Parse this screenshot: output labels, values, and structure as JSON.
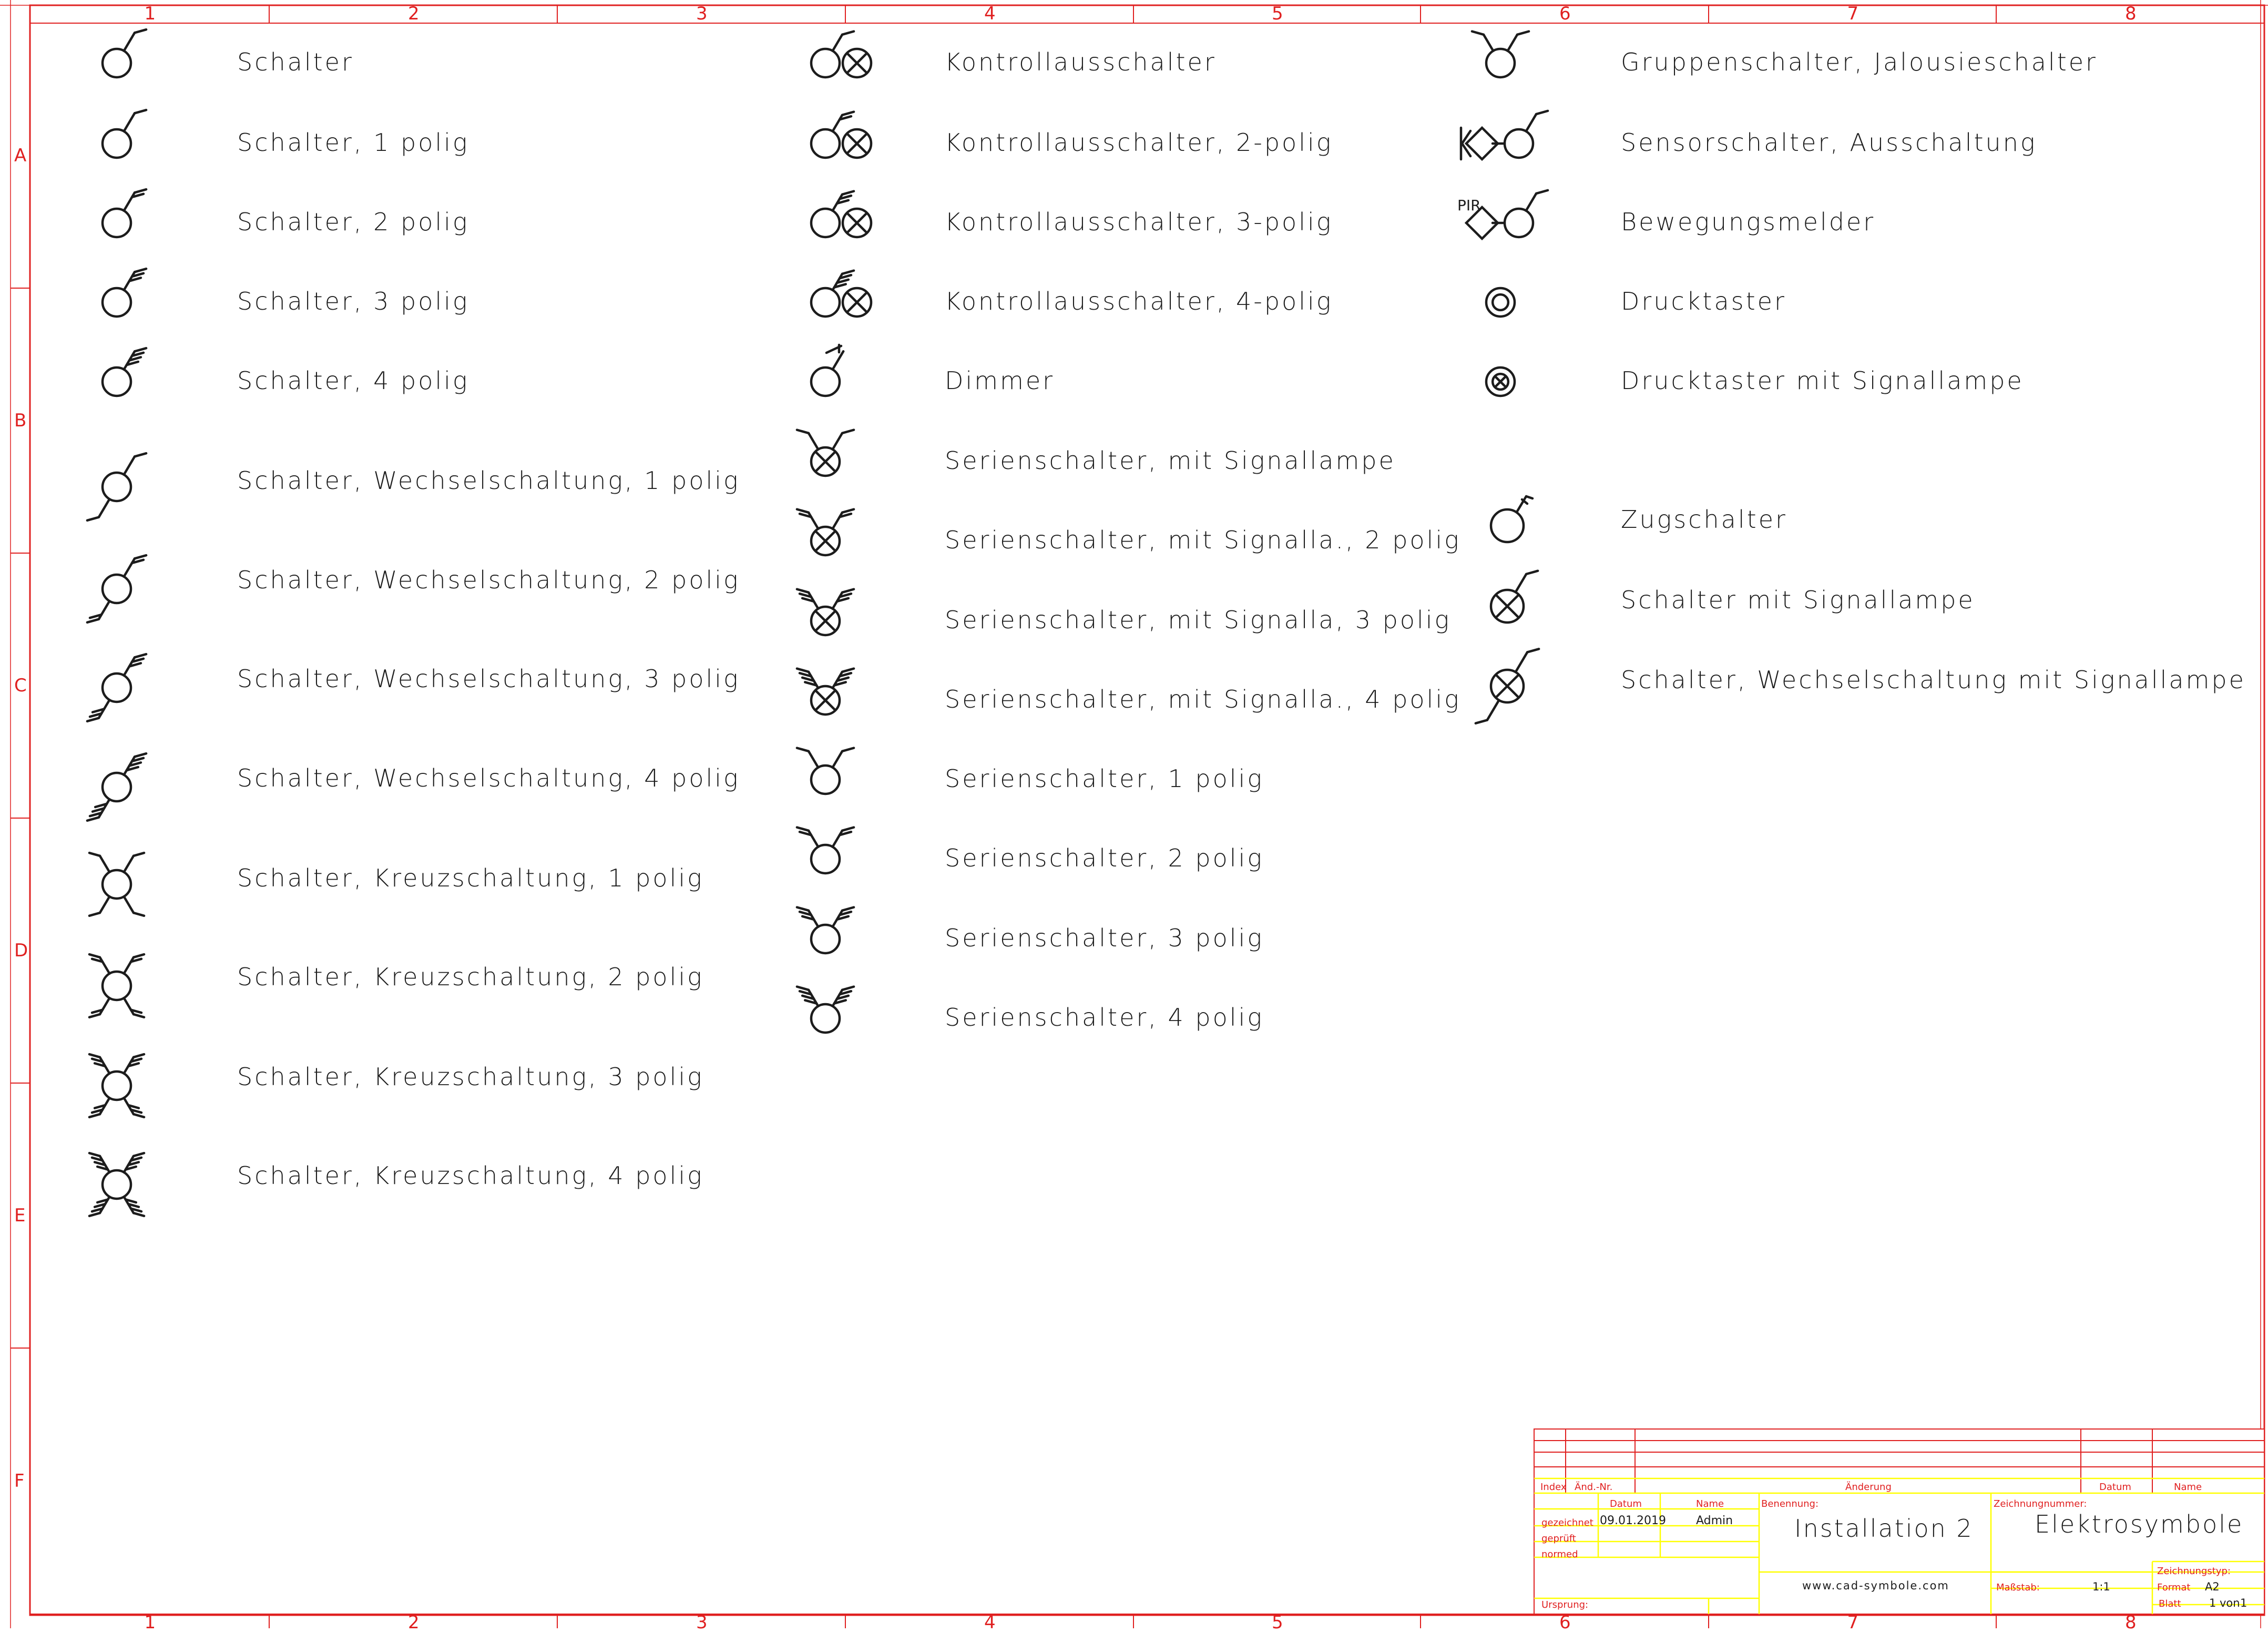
{
  "frame": {
    "columns": [
      "1",
      "2",
      "3",
      "4",
      "5",
      "6",
      "7",
      "8"
    ],
    "rows": [
      "A",
      "B",
      "C",
      "D",
      "E",
      "F"
    ]
  },
  "columns": {
    "left": [
      {
        "label": "Schalter",
        "symbol": "schalter"
      },
      {
        "label": "Schalter, 1 polig",
        "symbol": "schalter-1-polig"
      },
      {
        "label": "Schalter, 2 polig",
        "symbol": "schalter-2-polig"
      },
      {
        "label": "Schalter, 3 polig",
        "symbol": "schalter-3-polig"
      },
      {
        "label": "Schalter, 4 polig",
        "symbol": "schalter-4-polig"
      },
      {
        "label": "Schalter, Wechselschaltung, 1 polig",
        "symbol": "wechsel-1-polig"
      },
      {
        "label": "Schalter, Wechselschaltung, 2 polig",
        "symbol": "wechsel-2-polig"
      },
      {
        "label": "Schalter, Wechselschaltung, 3 polig",
        "symbol": "wechsel-3-polig"
      },
      {
        "label": "Schalter, Wechselschaltung, 4 polig",
        "symbol": "wechsel-4-polig"
      },
      {
        "label": "Schalter, Kreuzschaltung, 1 polig",
        "symbol": "kreuz-1-polig"
      },
      {
        "label": "Schalter, Kreuzschaltung, 2 polig",
        "symbol": "kreuz-2-polig"
      },
      {
        "label": "Schalter, Kreuzschaltung, 3 polig",
        "symbol": "kreuz-3-polig"
      },
      {
        "label": "Schalter, Kreuzschaltung, 4 polig",
        "symbol": "kreuz-4-polig"
      }
    ],
    "middle": [
      {
        "label": "Kontrollausschalter",
        "symbol": "kontroll"
      },
      {
        "label": "Kontrollausschalter, 2-polig",
        "symbol": "kontroll-2-polig"
      },
      {
        "label": "Kontrollausschalter, 3-polig",
        "symbol": "kontroll-3-polig"
      },
      {
        "label": "Kontrollausschalter, 4-polig",
        "symbol": "kontroll-4-polig"
      },
      {
        "label": "Dimmer",
        "symbol": "dimmer"
      },
      {
        "label": "Serienschalter, mit Signallampe",
        "symbol": "serien-signal"
      },
      {
        "label": "Serienschalter, mit Signalla., 2 polig",
        "symbol": "serien-signal-2-polig"
      },
      {
        "label": "Serienschalter, mit Signalla, 3 polig",
        "symbol": "serien-signal-3-polig"
      },
      {
        "label": "Serienschalter, mit Signalla., 4 polig",
        "symbol": "serien-signal-4-polig"
      },
      {
        "label": "Serienschalter, 1 polig",
        "symbol": "serien-1-polig"
      },
      {
        "label": "Serienschalter, 2 polig",
        "symbol": "serien-2-polig"
      },
      {
        "label": "Serienschalter, 3 polig",
        "symbol": "serien-3-polig"
      },
      {
        "label": "Serienschalter, 4 polig",
        "symbol": "serien-4-polig"
      }
    ],
    "right": [
      {
        "label": "Gruppenschalter, Jalousieschalter",
        "symbol": "gruppen"
      },
      {
        "label": "Sensorschalter, Ausschaltung",
        "symbol": "sensor"
      },
      {
        "label": "Bewegungsmelder",
        "symbol": "bewegung",
        "tag": "PIR"
      },
      {
        "label": "Drucktaster",
        "symbol": "drucktaster"
      },
      {
        "label": "Drucktaster mit Signallampe",
        "symbol": "drucktaster-signal"
      },
      {
        "label": "Zugschalter",
        "symbol": "zug"
      },
      {
        "label": "Schalter mit Signallampe",
        "symbol": "schalter-signal"
      },
      {
        "label": "Schalter, Wechselschaltung mit Signallampe",
        "symbol": "wechsel-signal"
      }
    ]
  },
  "title_block": {
    "headers": {
      "index": "Index",
      "aend_nr": "Änd.-Nr.",
      "aenderung": "Änderung",
      "datum": "Datum",
      "name": "Name"
    },
    "datum_label": "Datum",
    "name_label": "Name",
    "gezeichnet_label": "gezeichnet",
    "gezeichnet_date": "09.01.2019",
    "gezeichnet_name": "Admin",
    "geprueft_label": "geprüft",
    "normed_label": "normed",
    "ursprung_label": "Ursprung:",
    "benennung_label": "Benennung:",
    "benennung_value": "Installation 2",
    "website": "www.cad-symbole.com",
    "zeichnungsnummer_label": "Zeichnungnummer:",
    "zeichnungsnummer_value": "Elektrosymbole",
    "zeichnungstyp_label": "Zeichnungstyp:",
    "format_label": "Format",
    "format_value": "A2",
    "massstab_label": "Maßstab:",
    "massstab_value": "1:1",
    "blatt_label": "Blatt",
    "blatt_value": "1",
    "von_label": "von",
    "von_value": "1"
  },
  "colors": {
    "frame": "#e02020",
    "titleblock_fill": "#ffff00",
    "ink": "#1c1c1c"
  }
}
